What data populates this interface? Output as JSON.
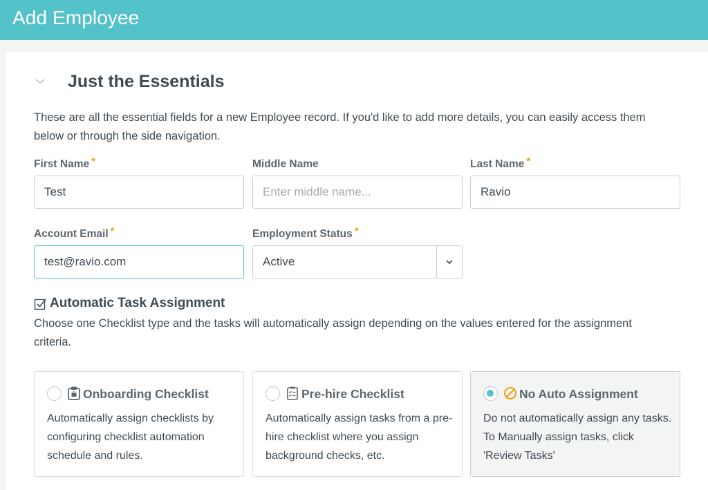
{
  "header": {
    "title": "Add Employee"
  },
  "section": {
    "title": "Just the Essentials",
    "description": "These are all the essential fields for a new Employee record. If you'd like to add more details, you can easily access them below or through the side navigation."
  },
  "fields": {
    "first_name": {
      "label": "First Name",
      "required": "*",
      "value": "Test"
    },
    "middle_name": {
      "label": "Middle Name",
      "placeholder": "Enter middle name..."
    },
    "last_name": {
      "label": "Last Name",
      "required": "*",
      "value": "Ravio"
    },
    "account_email": {
      "label": "Account Email",
      "required": "*",
      "value": "test@ravio.com"
    },
    "employment_status": {
      "label": "Employment Status",
      "required": "*",
      "value": "Active"
    }
  },
  "task_assignment": {
    "title": "Automatic Task Assignment",
    "description": "Choose one Checklist type and the tasks will automatically assign depending on the values entered for the assignment criteria.",
    "options": [
      {
        "title": "Onboarding Checklist",
        "icon": "clipboard-icon",
        "description": "Automatically assign checklists by configuring checklist automation schedule and rules.",
        "selected": false
      },
      {
        "title": "Pre-hire Checklist",
        "icon": "checklist-icon",
        "description": "Automatically assign tasks from a pre-hire checklist where you assign background checks, etc.",
        "selected": false
      },
      {
        "title": "No Auto Assignment",
        "icon": "prohibited-icon",
        "description": "Do not automatically assign any tasks. To Manually assign tasks, click 'Review Tasks'",
        "selected": true
      }
    ]
  },
  "colors": {
    "accent": "#54c2c9",
    "required": "#f39c12",
    "text": "#3f4a52",
    "label": "#5c666d",
    "prohibited": "#f39c12"
  }
}
